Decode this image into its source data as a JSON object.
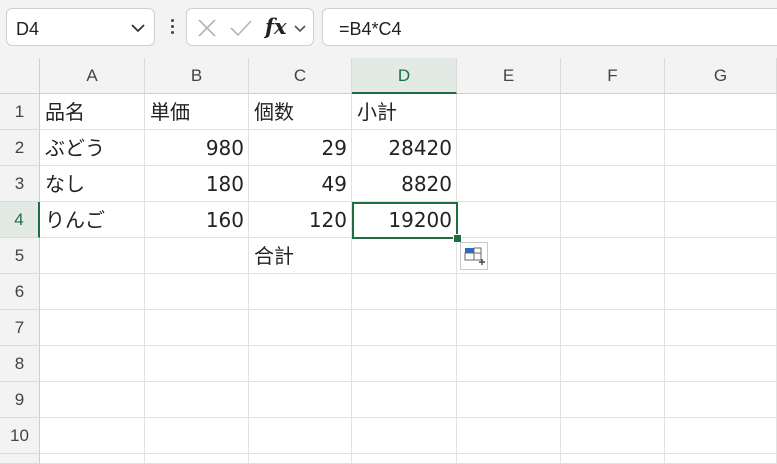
{
  "formula_bar": {
    "name_box": "D4",
    "formula": "=B4*C4",
    "fx_label": "fx"
  },
  "columns": [
    "A",
    "B",
    "C",
    "D",
    "E",
    "F",
    "G"
  ],
  "selected_column": "D",
  "rows": [
    "1",
    "2",
    "3",
    "4",
    "5",
    "6",
    "7",
    "8",
    "9",
    "10"
  ],
  "selected_row": "4",
  "cells": {
    "A1": "品名",
    "B1": "単価",
    "C1": "個数",
    "D1": "小計",
    "A2": "ぶどう",
    "B2": "980",
    "C2": "29",
    "D2": "28420",
    "A3": "なし",
    "B3": "180",
    "C3": "49",
    "D3": "8820",
    "A4": "りんご",
    "B4": "160",
    "C4": "120",
    "D4": "19200",
    "C5": "合計"
  },
  "colors": {
    "accent": "#1f6e43",
    "header_bg": "#f3f3f3",
    "grid_line": "#e1e1e1"
  },
  "icons": [
    "chevron-down-icon",
    "more-options-icon",
    "cancel-icon",
    "enter-icon",
    "fx-icon",
    "quick-analysis-icon"
  ]
}
